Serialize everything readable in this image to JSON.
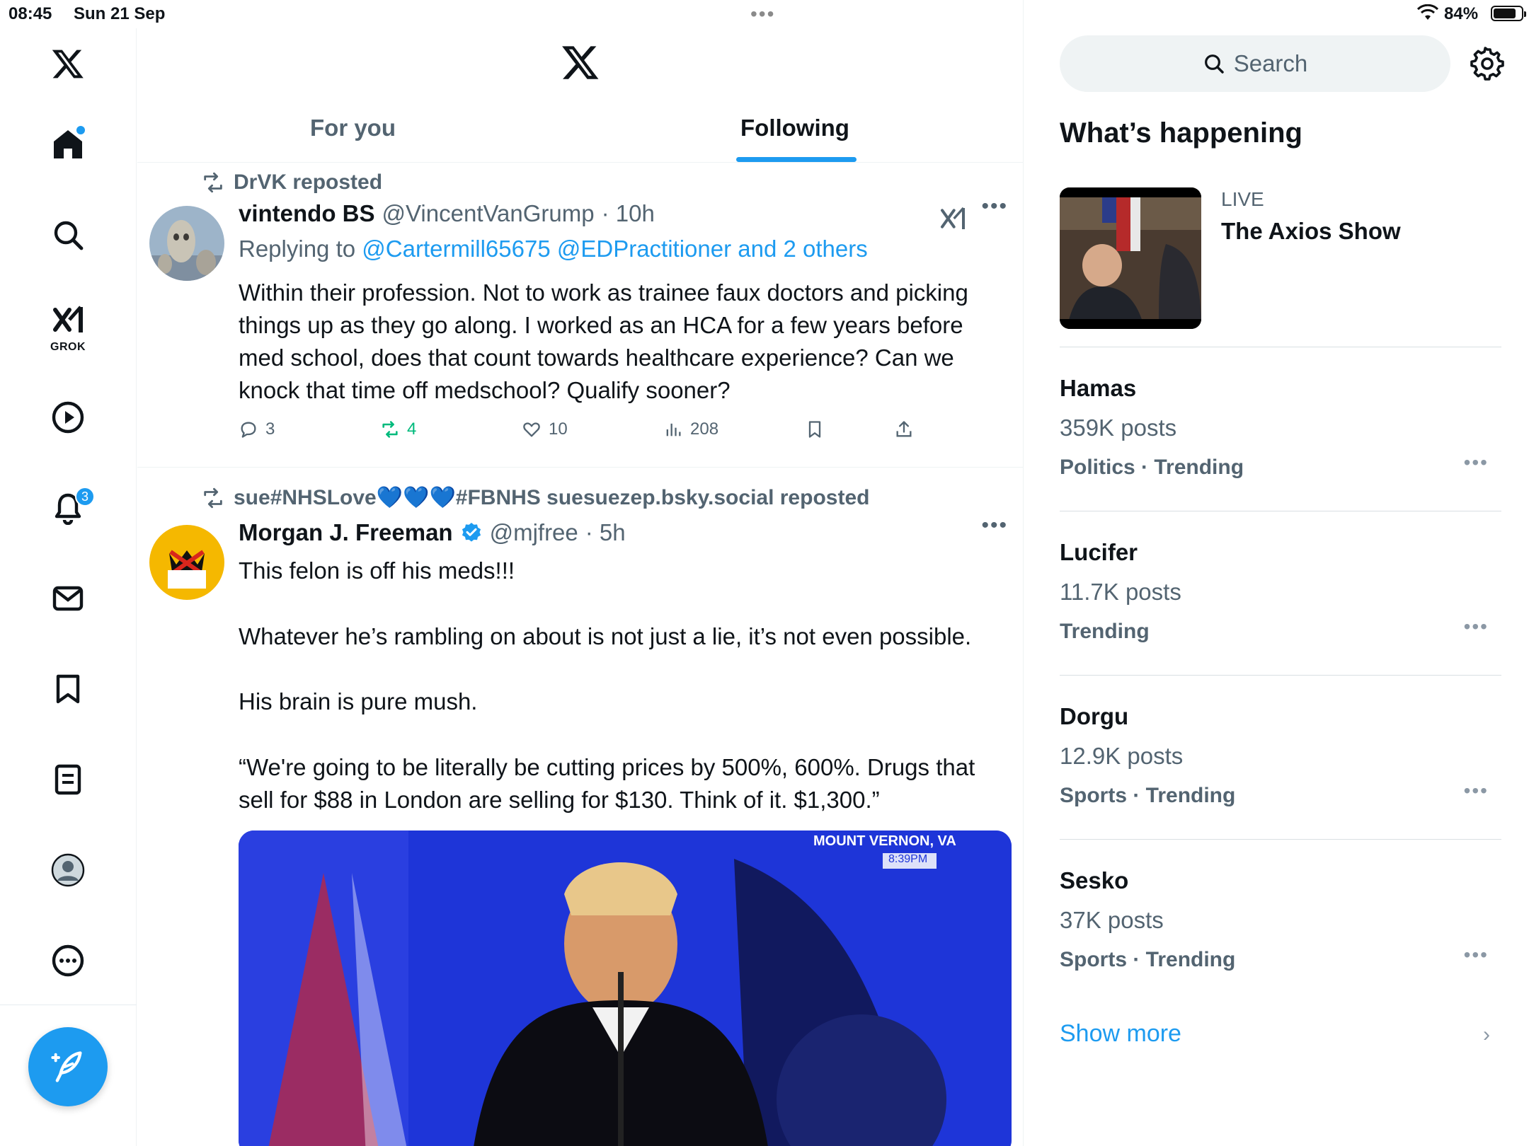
{
  "status_bar": {
    "time": "08:45",
    "date": "Sun 21 Sep",
    "battery_percent": "84%",
    "battery_level": 0.84
  },
  "nav": {
    "grok_label": "GROK",
    "notifications_badge": "3",
    "icons": [
      "x-logo-icon",
      "home-icon",
      "search-icon",
      "grok-icon",
      "video-icon",
      "bell-icon",
      "mail-icon",
      "bookmark-icon",
      "lists-icon",
      "profile-icon",
      "more-icon",
      "compose-icon"
    ]
  },
  "tabs": {
    "for_you": "For you",
    "following": "Following",
    "active": "following"
  },
  "posts": [
    {
      "reposted_by": "DrVK reposted",
      "name": "vintendo BS",
      "handle": "@VincentVanGrump",
      "time": "· 10h",
      "replying_prefix": "Replying to ",
      "replying_mentions": "@Cartermill65675 @EDPractitioner and 2 others",
      "text": "Within their profession. Not to work as trainee faux doctors and picking things up as they go along. I worked as an HCA for a few years before med school, does that count towards healthcare experience? Can we knock that time off medschool? Qualify sooner?",
      "replies": "3",
      "reposts": "4",
      "likes": "10",
      "views": "208"
    },
    {
      "reposted_by": "sue#NHSLove💙💙💙#FBNHS suesuezep.bsky.social reposted",
      "name": "Morgan J. Freeman",
      "handle": "@mjfree",
      "time": "· 5h",
      "text": "This felon is off his meds!!!\n\nWhatever he’s rambling on about is not just a lie, it’s not even possible.\n\nHis brain is pure mush.\n\n“We're going to be literally be cutting prices by 500%, 600%. Drugs that sell for $88 in London are selling for $130. Think of it. $1,300.”",
      "media_caption": "MOUNT VERNON, VA",
      "media_time": "8:39PM"
    }
  ],
  "right": {
    "search_placeholder": "Search",
    "whats_happening": "What’s happening",
    "live_tag": "LIVE",
    "live_title": "The Axios Show",
    "trends": [
      {
        "title": "Hamas",
        "count": "359K posts",
        "category": "Politics · Trending"
      },
      {
        "title": "Lucifer",
        "count": "11.7K posts",
        "category": "Trending"
      },
      {
        "title": "Dorgu",
        "count": "12.9K posts",
        "category": "Sports · Trending"
      },
      {
        "title": "Sesko",
        "count": "37K posts",
        "category": "Sports · Trending"
      }
    ],
    "show_more": "Show more"
  },
  "colors": {
    "accent": "#1d9bf0",
    "muted": "#536471",
    "repost_green": "#00ba7c",
    "text": "#0f1419"
  }
}
